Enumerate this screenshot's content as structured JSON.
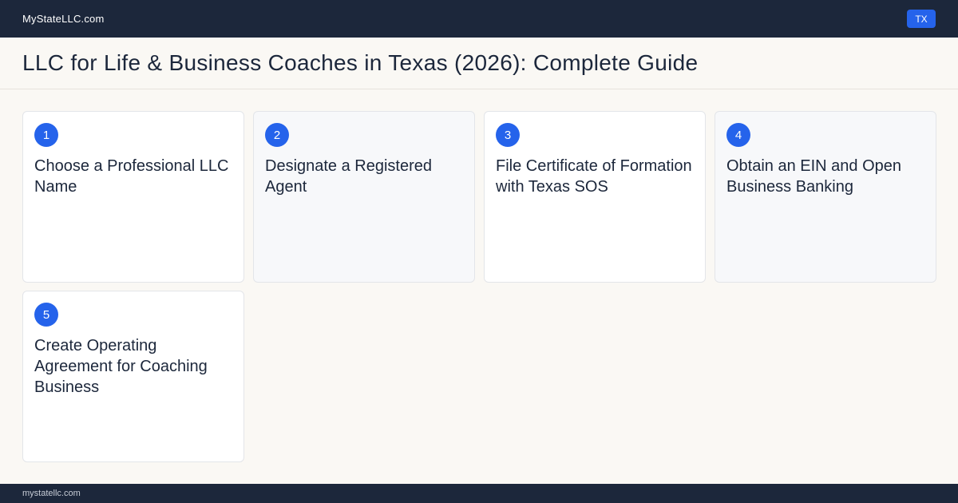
{
  "header": {
    "brand": "MyStateLLC.com",
    "state_badge": "TX"
  },
  "page": {
    "title": "LLC for Life & Business Coaches in Texas (2026): Complete Guide"
  },
  "steps": [
    {
      "number": "1",
      "title": "Choose a Professional LLC Name"
    },
    {
      "number": "2",
      "title": "Designate a Registered Agent"
    },
    {
      "number": "3",
      "title": "File Certificate of Formation with Texas SOS"
    },
    {
      "number": "4",
      "title": "Obtain an EIN and Open Business Banking"
    },
    {
      "number": "5",
      "title": "Create Operating Agreement for Coaching Business"
    }
  ],
  "footer": {
    "url": "mystatellc.com"
  },
  "colors": {
    "nav_bg": "#1c273b",
    "accent": "#2563eb",
    "page_bg": "#faf8f4"
  }
}
